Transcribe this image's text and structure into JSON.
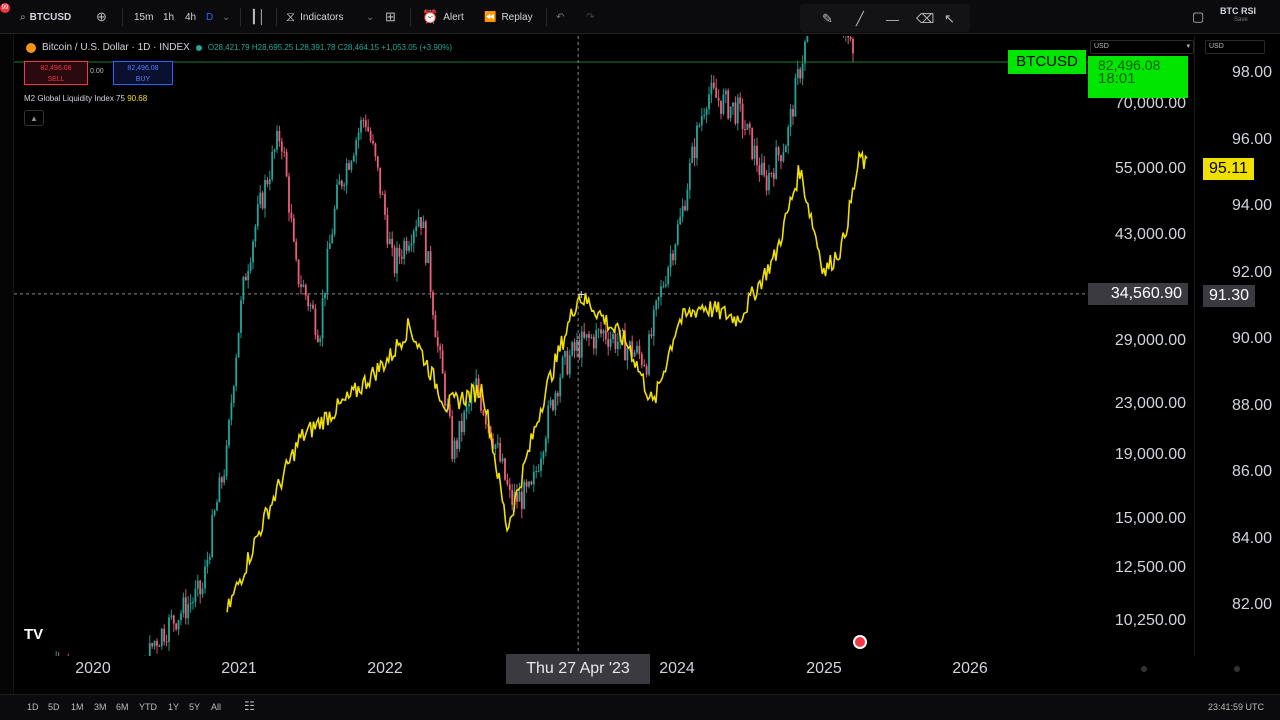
{
  "toolbar": {
    "notif_count": "99",
    "symbol": "BTCUSD",
    "intervals": [
      "15m",
      "1h",
      "4h",
      "D"
    ],
    "indicators_label": "Indicators",
    "alert_label": "Alert",
    "replay_label": "Replay",
    "right_symbol": "BTC RSI",
    "right_symbol_sub": "Save"
  },
  "legend": {
    "title": "Bitcoin / U.S. Dollar · 1D · INDEX",
    "ohlc": "O28,421.79 H28,695.25 L28,391.78 C28,464.15 +1,053.05 (+3.90%)",
    "sell_price": "82,496.08",
    "sell_label": "SELL",
    "spread": "0.00",
    "buy_price": "82,496.08",
    "buy_label": "BUY",
    "indicator": "M2 Global Liquidity Index 75",
    "indicator_value": "90.68"
  },
  "price_scale_left": {
    "unit": "USD",
    "ticks": [
      "70,000.00",
      "55,000.00",
      "43,000.00",
      "29,000.00",
      "23,000.00",
      "19,000.00",
      "15,000.00",
      "12,500.00",
      "10,250.00"
    ],
    "crosshair_value": "34,560.90",
    "symbol_tag": "BTCUSD",
    "current_price": "82,496.08",
    "countdown": "18:01"
  },
  "price_scale_right": {
    "unit": "USD",
    "ticks": [
      "98.00",
      "96.00",
      "94.00",
      "92.00",
      "90.00",
      "88.00",
      "86.00",
      "84.00",
      "82.00"
    ],
    "current_value": "95.11",
    "crosshair_value": "91.30"
  },
  "time_axis": {
    "labels": [
      "2020",
      "2021",
      "2022",
      "2024",
      "2025",
      "2026"
    ],
    "crosshair_time": "Thu 27 Apr '23"
  },
  "bottom_bar": {
    "ranges": [
      "1D",
      "5D",
      "1M",
      "3M",
      "6M",
      "YTD",
      "1Y",
      "5Y",
      "All"
    ],
    "clock": "23:41:59 UTC"
  },
  "colors": {
    "background": "#000000",
    "candle_up": "#26a69a",
    "candle_down": "#ef5f7c",
    "liquidity_line": "#f0e000",
    "current_price_tag": "#00e600",
    "indicator_tag": "#f0e000"
  },
  "chart_data": {
    "type": "line",
    "x": [
      "2020",
      "2021",
      "2022",
      "2023",
      "2024",
      "2025",
      "2026"
    ],
    "series": [
      {
        "name": "Bitcoin / U.S. Dollar · 1D · INDEX",
        "axis": "left",
        "y_scale": "log",
        "points": [
          [
            "2019-10-01",
            9000
          ],
          [
            "2020-01-01",
            7900
          ],
          [
            "2020-03-15",
            6500
          ],
          [
            "2020-06-01",
            9500
          ],
          [
            "2020-10-01",
            11500
          ],
          [
            "2020-12-01",
            19000
          ],
          [
            "2021-01-15",
            37000
          ],
          [
            "2021-04-14",
            63000
          ],
          [
            "2021-05-20",
            38000
          ],
          [
            "2021-07-20",
            30000
          ],
          [
            "2021-09-05",
            51000
          ],
          [
            "2021-11-10",
            67000
          ],
          [
            "2022-01-20",
            38000
          ],
          [
            "2022-03-28",
            47000
          ],
          [
            "2022-05-12",
            28000
          ],
          [
            "2022-06-18",
            19000
          ],
          [
            "2022-08-15",
            24500
          ],
          [
            "2022-11-09",
            16000
          ],
          [
            "2023-01-01",
            16500
          ],
          [
            "2023-03-15",
            26000
          ],
          [
            "2023-04-27",
            28460
          ],
          [
            "2023-07-01",
            30000
          ],
          [
            "2023-10-15",
            27000
          ],
          [
            "2024-01-10",
            46000
          ],
          [
            "2024-03-14",
            73000
          ],
          [
            "2024-06-01",
            68000
          ],
          [
            "2024-08-05",
            52000
          ],
          [
            "2024-10-01",
            62000
          ],
          [
            "2024-12-17",
            106000
          ],
          [
            "2025-01-20",
            108000
          ],
          [
            "2025-03-15",
            82496
          ]
        ]
      },
      {
        "name": "M2 Global Liquidity Index 75",
        "axis": "right",
        "y_scale": "linear",
        "points": [
          [
            "2020-12-01",
            81.8
          ],
          [
            "2021-03-01",
            84.5
          ],
          [
            "2021-06-01",
            87.0
          ],
          [
            "2021-10-01",
            88.2
          ],
          [
            "2022-01-15",
            89.5
          ],
          [
            "2022-03-01",
            90.4
          ],
          [
            "2022-06-01",
            88.0
          ],
          [
            "2022-09-01",
            88.5
          ],
          [
            "2022-11-01",
            84.3
          ],
          [
            "2023-02-01",
            88.3
          ],
          [
            "2023-04-27",
            91.3
          ],
          [
            "2023-06-01",
            91.0
          ],
          [
            "2023-09-01",
            89.8
          ],
          [
            "2023-11-01",
            88.0
          ],
          [
            "2024-01-01",
            90.5
          ],
          [
            "2024-03-01",
            91.0
          ],
          [
            "2024-06-01",
            90.6
          ],
          [
            "2024-09-01",
            92.5
          ],
          [
            "2024-11-01",
            95.1
          ],
          [
            "2025-01-01",
            92.0
          ],
          [
            "2025-02-15",
            92.8
          ],
          [
            "2025-04-01",
            95.5
          ],
          [
            "2025-04-20",
            95.11
          ]
        ]
      }
    ],
    "ylim_left": [
      9500,
      120000
    ],
    "ylim_right": [
      81.5,
      98.8
    ],
    "crosshair": {
      "date": "2023-04-27",
      "left_value": 34560.9,
      "right_value": 91.3
    },
    "grid": false
  }
}
